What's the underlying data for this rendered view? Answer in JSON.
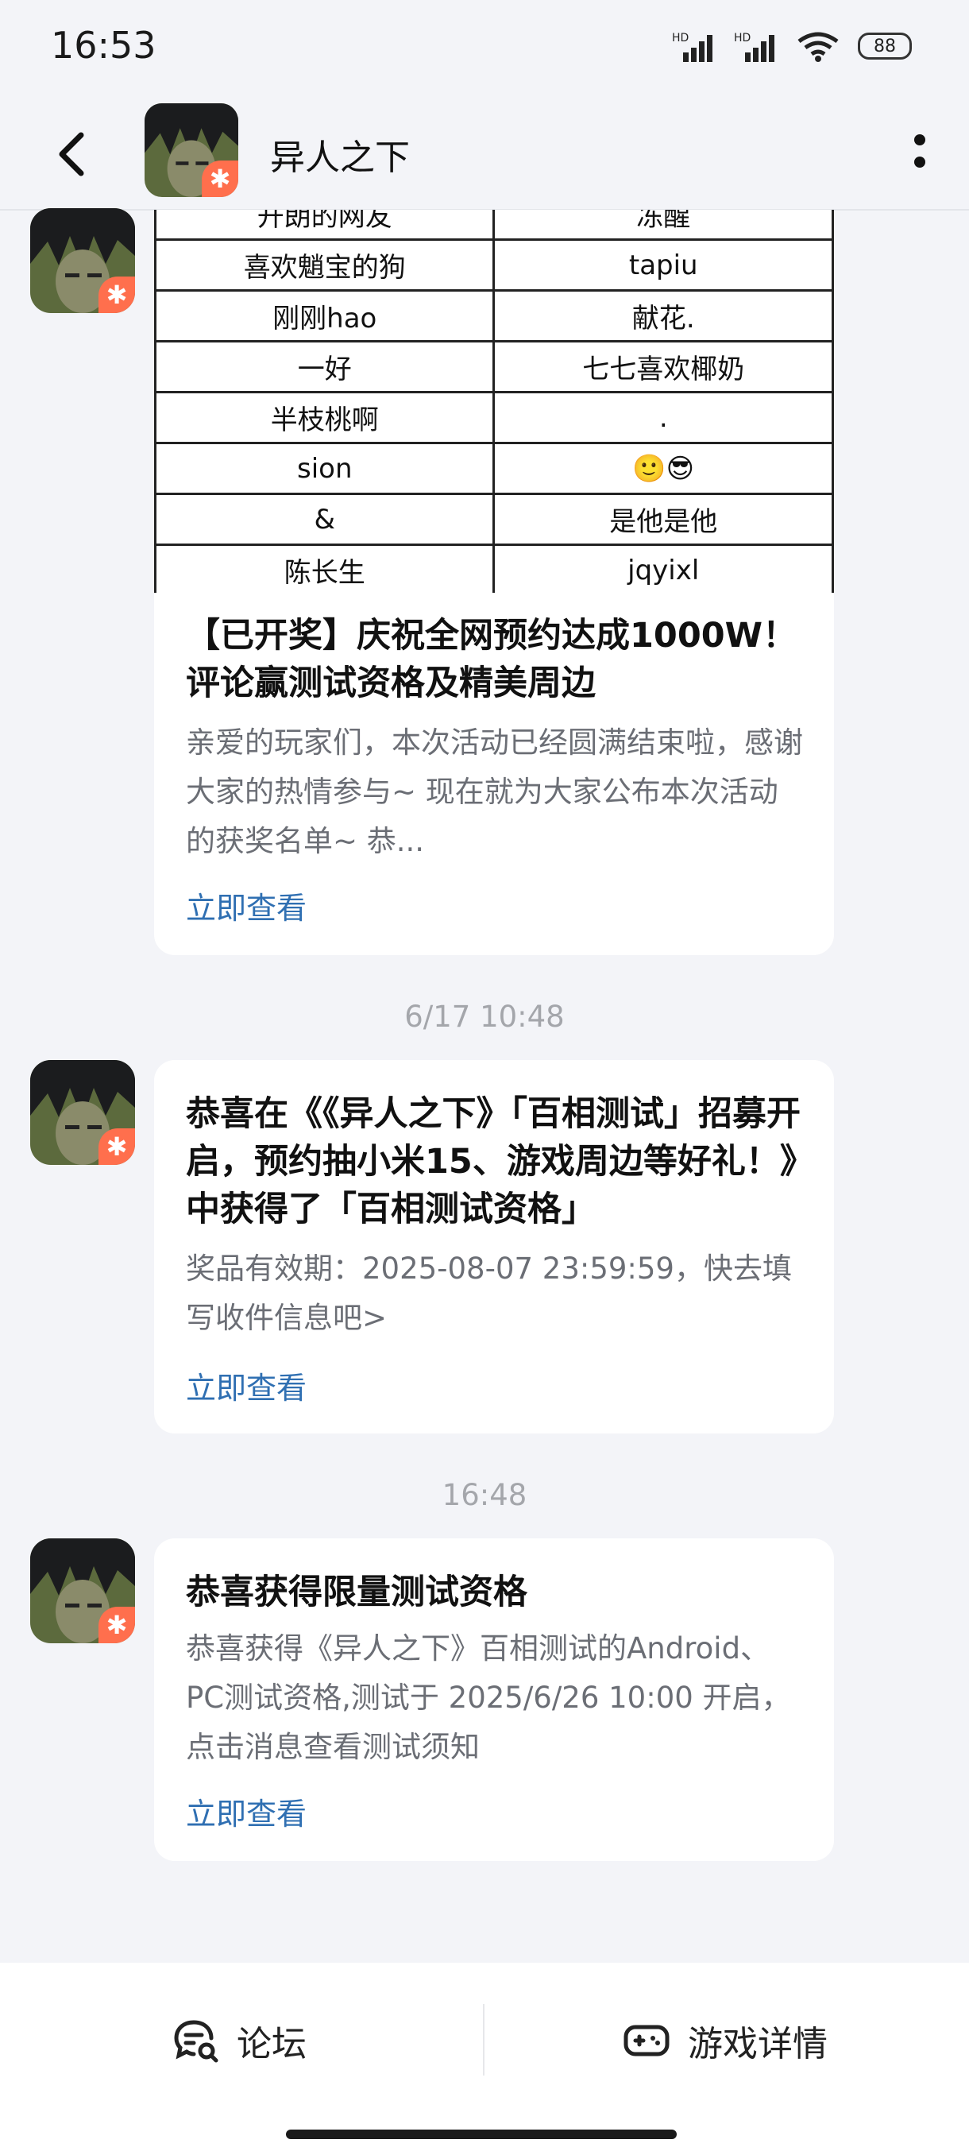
{
  "status_bar": {
    "time": "16:53",
    "battery": "88",
    "signal1": "HD",
    "signal2": "HD"
  },
  "header": {
    "title": "异人之下"
  },
  "table_rows": [
    [
      "开朗的网友",
      "冻醒"
    ],
    [
      "喜欢魈宝的狗",
      "tapiu"
    ],
    [
      "刚刚hao",
      "献花."
    ],
    [
      "一好",
      "七七喜欢椰奶"
    ],
    [
      "半枝桃啊",
      "."
    ],
    [
      "sion",
      "🙂😎"
    ],
    [
      "&",
      "是他是他"
    ],
    [
      "陈长生",
      "jqyixl"
    ]
  ],
  "messages": [
    {
      "title": "【已开奖】庆祝全网预约达成1000W！评论赢测试资格及精美周边",
      "body": "亲爱的玩家们，本次活动已经圆满结束啦，感谢大家的热情参与~ 现在就为大家公布本次活动的获奖名单~ 恭...",
      "link": "立即查看"
    },
    {
      "timestamp": "6/17  10:48",
      "title": "恭喜在《《异人之下》「百相测试」招募开启，预约抽小米15、游戏周边等好礼！》中获得了「百相测试资格」",
      "body": "奖品有效期：2025-08-07 23:59:59，快去填写收件信息吧>",
      "link": "立即查看"
    },
    {
      "timestamp": "16:48",
      "title": "恭喜获得限量测试资格",
      "body": "恭喜获得《异人之下》百相测试的Android、PC测试资格,测试于 2025/6/26 10:00 开启，点击消息查看测试须知",
      "link": "立即查看"
    }
  ],
  "bottom_bar": {
    "forum": "论坛",
    "game_details": "游戏详情"
  },
  "icons": {
    "back": "back-arrow-icon",
    "more": "more-vertical-icon",
    "forum": "forum-chat-icon",
    "game": "gamepad-icon",
    "avatar": "game-avatar-icon"
  },
  "colors": {
    "link": "#2f6fb2",
    "badge": "#ff6f4d",
    "background": "#f3f4f8"
  }
}
